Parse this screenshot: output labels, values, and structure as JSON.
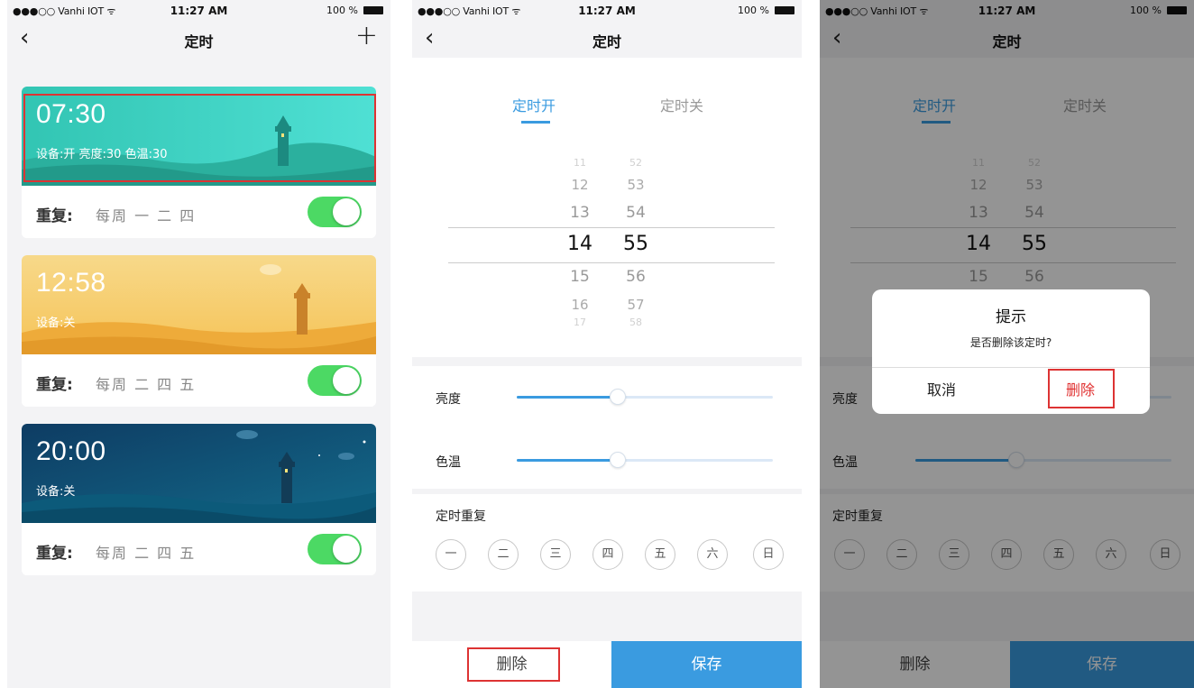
{
  "status_bar": {
    "carrier": "●●●○○ Vanhi IOT ᯤ",
    "time": "11:27 AM",
    "battery": "100 %"
  },
  "colors": {
    "accent": "#3a9be0",
    "toggle_on": "#4cd964",
    "highlight": "#dd3333",
    "danger": "#e03131"
  },
  "list_screen": {
    "title": "定时",
    "back_icon": "chevron-left-icon",
    "add_icon": "plus-icon",
    "timers": [
      {
        "time": "07:30",
        "detail": "设备:开 亮度:30 色温:30",
        "repeat_label": "重复:",
        "repeat_days": "每周 一 二 四",
        "enabled": true,
        "theme": "teal"
      },
      {
        "time": "12:58",
        "detail": "设备:关",
        "repeat_label": "重复:",
        "repeat_days": "每周 二 四 五",
        "enabled": true,
        "theme": "golden"
      },
      {
        "time": "20:00",
        "detail": "设备:关",
        "repeat_label": "重复:",
        "repeat_days": "每周 二 四 五",
        "enabled": true,
        "theme": "night"
      }
    ]
  },
  "edit_screen": {
    "title": "定时",
    "tab_on": "定时开",
    "tab_off": "定时关",
    "hours": [
      "11",
      "12",
      "13",
      "14",
      "15",
      "16",
      "17"
    ],
    "minutes": [
      "52",
      "53",
      "54",
      "55",
      "56",
      "57",
      "58"
    ],
    "selected_hour": "14",
    "selected_minute": "55",
    "brightness_label": "亮度",
    "brightness_value": 0.42,
    "color_temp_label": "色温",
    "color_temp_value": 0.42,
    "repeat_label": "定时重复",
    "weekdays": [
      "一",
      "二",
      "三",
      "四",
      "五",
      "六",
      "日"
    ],
    "delete_label": "删除",
    "save_label": "保存"
  },
  "confirm_dialog": {
    "title": "提示",
    "message": "是否删除该定时?",
    "cancel_label": "取消",
    "confirm_label": "删除"
  }
}
